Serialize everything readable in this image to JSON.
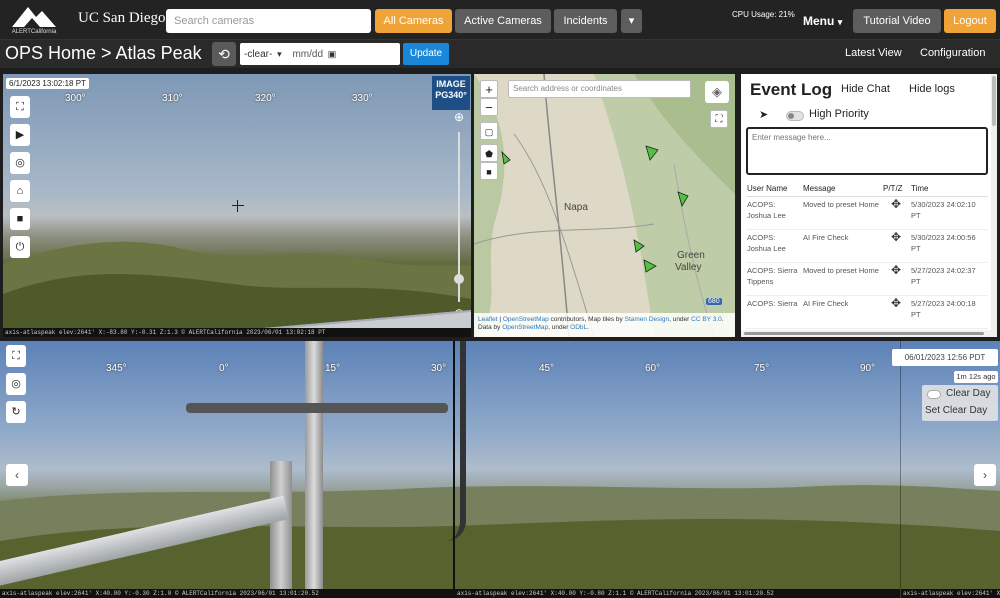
{
  "app": {
    "logo_text": "ALERTCalifornia",
    "org_name": "UC San Diego"
  },
  "topbar": {
    "search_placeholder": "Search cameras",
    "buttons": [
      {
        "label": "All Cameras",
        "style": "orange"
      },
      {
        "label": "Active Cameras",
        "style": "grey"
      },
      {
        "label": "Incidents",
        "style": "grey"
      }
    ],
    "dropdown_caret": "▾",
    "cpu_usage": "CPU Usage: 21%",
    "menu_label": "Menu",
    "tutorial_label": "Tutorial Video",
    "logout_label": "Logout"
  },
  "subbar": {
    "title": "OPS Home > Atlas Peak",
    "time_option": "-clear-",
    "date_placeholder": "mm/dd",
    "update_label": "Update",
    "latest_view_label": "Latest View",
    "configuration_label": "Configuration"
  },
  "camera": {
    "timestamp": "6/1/2023 13:02:18 PT",
    "degrees": [
      "300°",
      "310°",
      "320°",
      "330°"
    ],
    "badge_line1": "IMAGE",
    "badge_line2": "PG340°",
    "footer": "axis-atlaspeak elev:2641' X:-83.80 Y:-0.31 Z:1.3  © ALERTCalifornia 2023/06/01 13:02:18 PT"
  },
  "map": {
    "search_placeholder": "Search address or coordinates",
    "zoom_in": "+",
    "zoom_out": "−",
    "labels": [
      {
        "text": "Napa"
      },
      {
        "text": "Green"
      },
      {
        "text": "Valley"
      },
      {
        "text": "680"
      }
    ],
    "attribution": {
      "leaflet": "Leaflet",
      "osm": "OpenStreetMap",
      "contrib": "contributors, Map tiles by",
      "stamen": "Stamen Design",
      "under": "under",
      "cc": "CC BY 3.0",
      "data_by": "Data by",
      "osm2": "OpenStreetMap",
      "under2": "under",
      "odbl": "ODbL"
    }
  },
  "eventlog": {
    "title": "Event Log",
    "hide_chat": "Hide Chat",
    "hide_logs": "Hide logs",
    "high_priority": "High Priority",
    "message_placeholder": "Enter message here...",
    "columns": [
      "User Name",
      "Message",
      "P/T/Z",
      "Time"
    ],
    "rows": [
      {
        "user": "ACOPS: Joshua Lee",
        "message": "Moved to preset Home",
        "time": "5/30/2023 24:02:10 PT"
      },
      {
        "user": "ACOPS: Joshua Lee",
        "message": "AI Fire Check",
        "time": "5/30/2023 24:00:56 PT"
      },
      {
        "user": "ACOPS: Sierra Tippens",
        "message": "Moved to preset Home",
        "time": "5/27/2023 24:02:37 PT"
      },
      {
        "user": "ACOPS: Sierra",
        "message": "AI Fire Check",
        "time": "5/27/2023 24:00:18 PT"
      }
    ]
  },
  "panorama": {
    "degrees": [
      "345°",
      "0°",
      "15°",
      "30°",
      "45°",
      "60°",
      "75°",
      "90°"
    ],
    "timestamp": "06/01/2023 12:56 PDT",
    "ago": "1m 12s ago",
    "clear_day": "Clear Day",
    "set_clear_day": "Set Clear Day",
    "footer_left": "axis-atlaspeak elev:2641' X:40.00 Y:-0.30 Z:1.0  © ALERTCalifornia 2023/06/01 13:01:20.52",
    "footer_right": "axis-atlaspeak elev:2641' X:40.00 Y:-0.80 Z:1.1  © ALERTCalifornia 2023/06/01 13:01:20.52",
    "footer_far": "axis-atlaspeak elev:2641' X:"
  }
}
